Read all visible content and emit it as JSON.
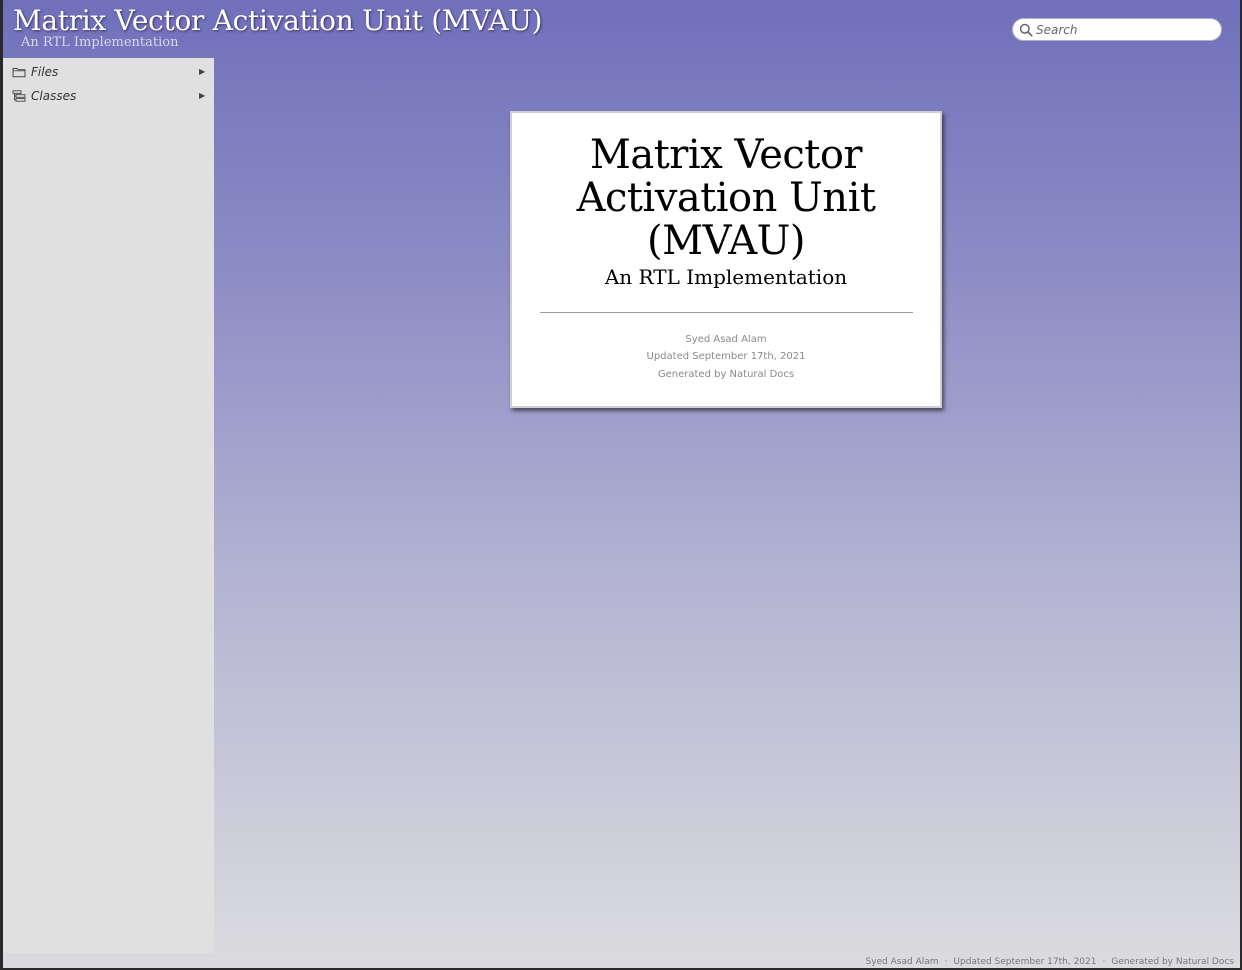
{
  "header": {
    "title": "Matrix Vector Activation Unit (MVAU)",
    "subtitle": "An RTL Implementation"
  },
  "search": {
    "placeholder": "Search",
    "value": ""
  },
  "sidebar": {
    "items": [
      {
        "label": "Files",
        "icon": "folder-icon",
        "arrow": "▶"
      },
      {
        "label": "Classes",
        "icon": "class-hierarchy-icon",
        "arrow": "▶"
      }
    ]
  },
  "title_card": {
    "title": "Matrix Vector Activation Unit (MVAU)",
    "subtitle": "An RTL Implementation",
    "author": "Syed Asad Alam",
    "updated": "Updated September 17th, 2021",
    "generated": "Generated by Natural Docs"
  },
  "footer": {
    "author": "Syed Asad Alam",
    "separator": "·",
    "updated": "Updated September 17th, 2021",
    "generated": "Generated by Natural Docs"
  },
  "colors": {
    "gradient_top": "#7070bb",
    "gradient_bottom": "#dcdcdf",
    "sidebar_bg": "#e0e0e0",
    "card_bg": "#ffffff"
  }
}
